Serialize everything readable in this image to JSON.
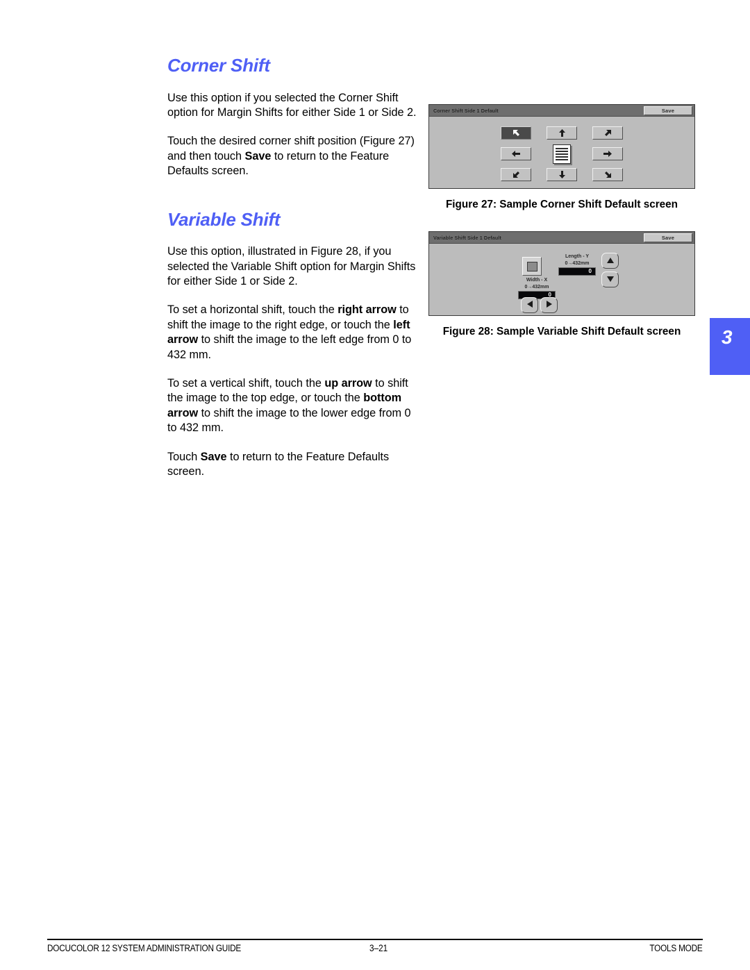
{
  "sections": [
    {
      "heading": "Corner Shift",
      "paragraphs": [
        [
          {
            "t": "Use this option if you selected the Corner Shift option for Margin Shifts for either Side 1 or Side 2.",
            "b": false
          }
        ],
        [
          {
            "t": "Touch the desired corner shift position (Figure 27) and then touch ",
            "b": false
          },
          {
            "t": "Save",
            "b": true
          },
          {
            "t": " to return to the Feature Defaults screen.",
            "b": false
          }
        ]
      ]
    },
    {
      "heading": "Variable Shift",
      "paragraphs": [
        [
          {
            "t": "Use this option, illustrated in Figure 28, if you selected the Variable Shift option for Margin Shifts for either Side 1 or Side 2.",
            "b": false
          }
        ],
        [
          {
            "t": "To set a horizontal shift, touch the ",
            "b": false
          },
          {
            "t": "right arrow",
            "b": true
          },
          {
            "t": " to shift the image to the right edge, or touch the ",
            "b": false
          },
          {
            "t": "left arrow",
            "b": true
          },
          {
            "t": " to shift the image to the left edge from 0 to 432 mm.",
            "b": false
          }
        ],
        [
          {
            "t": "To set a vertical shift, touch the ",
            "b": false
          },
          {
            "t": "up arrow",
            "b": true
          },
          {
            "t": " to shift the image to the top edge, or touch the ",
            "b": false
          },
          {
            "t": "bottom arrow",
            "b": true
          },
          {
            "t": " to shift the image to the lower edge from 0 to 432 mm.",
            "b": false
          }
        ],
        [
          {
            "t": "Touch ",
            "b": false
          },
          {
            "t": "Save",
            "b": true
          },
          {
            "t": " to return to the Feature Defaults screen.",
            "b": false
          }
        ]
      ]
    }
  ],
  "figure_27": {
    "caption": "Figure 27: Sample Corner Shift Default screen",
    "screen": {
      "title": "Corner Shift Side 1 Default",
      "save_label": "Save",
      "buttons": [
        {
          "name": "corner-shift-up-left-button",
          "icon": "arrow-up-left-icon",
          "selected": true
        },
        {
          "name": "corner-shift-up-button",
          "icon": "arrow-up-icon",
          "selected": false
        },
        {
          "name": "corner-shift-up-right-button",
          "icon": "arrow-up-right-icon",
          "selected": false
        },
        {
          "name": "corner-shift-left-button",
          "icon": "arrow-left-icon",
          "selected": false
        },
        {
          "name": "corner-shift-center-image",
          "icon": "document-icon",
          "selected": false
        },
        {
          "name": "corner-shift-right-button",
          "icon": "arrow-right-icon",
          "selected": false
        },
        {
          "name": "corner-shift-down-left-button",
          "icon": "arrow-down-left-icon",
          "selected": false
        },
        {
          "name": "corner-shift-down-button",
          "icon": "arrow-down-icon",
          "selected": false
        },
        {
          "name": "corner-shift-down-right-button",
          "icon": "arrow-down-right-icon",
          "selected": false
        }
      ]
    }
  },
  "figure_28": {
    "caption": "Figure 28: Sample Variable Shift Default screen",
    "screen": {
      "title": "Variable Shift Side 1 Default",
      "save_label": "Save",
      "length": {
        "label": "Length - Y",
        "range": "0→432mm",
        "value": "0"
      },
      "width": {
        "label": "Width - X",
        "range": "0→432mm",
        "value": "0"
      },
      "arrows": {
        "up": "arrow-up-icon",
        "down": "arrow-down-icon",
        "left": "arrow-left-icon",
        "right": "arrow-right-icon"
      }
    }
  },
  "chapter_tab": {
    "number": "3",
    "color": "#4f5ff5"
  },
  "footer": {
    "left": "DOCUCOLOR 12 SYSTEM ADMINISTRATION GUIDE",
    "page": "3–21",
    "right": "TOOLS MODE"
  }
}
